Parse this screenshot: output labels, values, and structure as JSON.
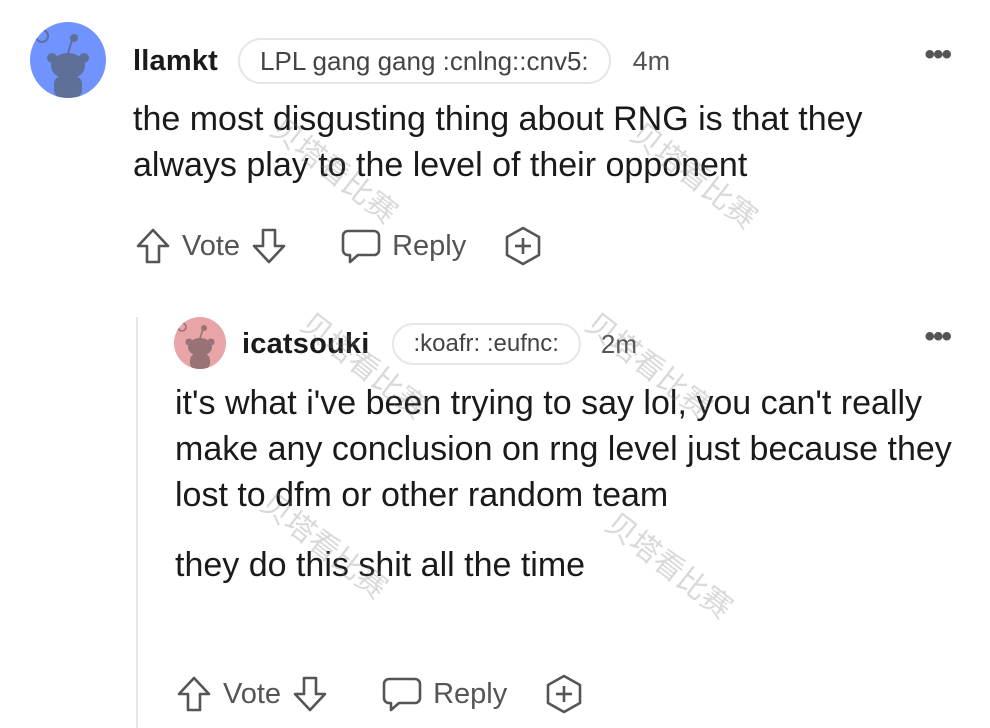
{
  "comments": [
    {
      "username": "llamkt",
      "flair": "LPL gang gang :cnlng::cnv5:",
      "time": "4m",
      "paragraphs": [
        "the most disgusting thing about RNG is that they always play to the level of their opponent"
      ],
      "avatar_color": "#7193ff",
      "actions": {
        "vote_label": "Vote",
        "reply_label": "Reply"
      }
    },
    {
      "username": "icatsouki",
      "flair": ":koafr: :eufnc:",
      "time": "2m",
      "paragraphs": [
        "it's what i've been trying to say lol, you can't really make any conclusion on rng level just because they lost to dfm or other random team",
        "they do this shit all the time"
      ],
      "avatar_color": "#e8a4a6",
      "actions": {
        "vote_label": "Vote",
        "reply_label": "Reply"
      }
    }
  ],
  "more_icon": "more-horizontal-icon",
  "watermark_text": "贝塔看比赛"
}
